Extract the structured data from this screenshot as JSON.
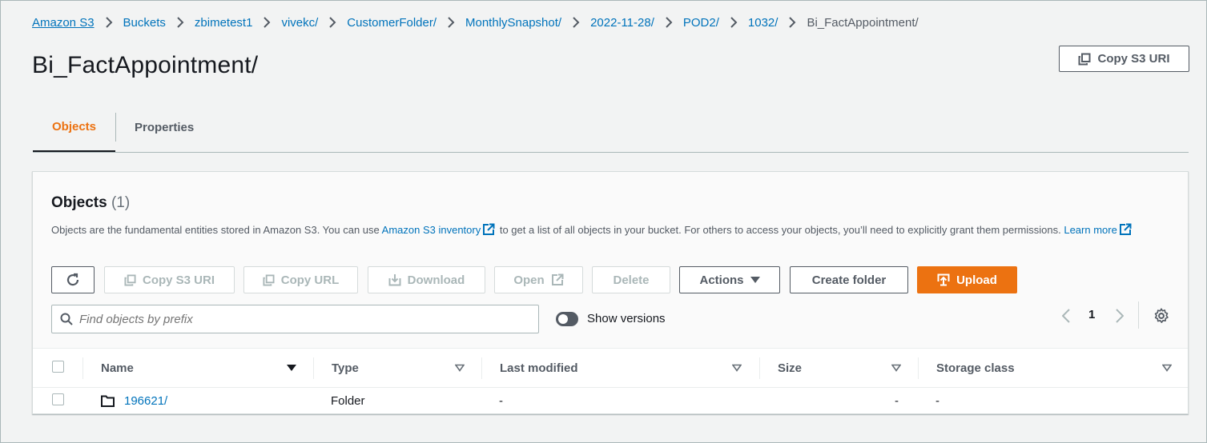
{
  "breadcrumb": [
    "Amazon S3",
    "Buckets",
    "zbimetest1",
    "vivekc/",
    "CustomerFolder/",
    "MonthlySnapshot/",
    "2022-11-28/",
    "POD2/",
    "1032/",
    "Bi_FactAppointment/"
  ],
  "page": {
    "title": "Bi_FactAppointment/",
    "copy_s3_uri_label": "Copy S3 URI"
  },
  "tabs": [
    {
      "label": "Objects",
      "active": true
    },
    {
      "label": "Properties",
      "active": false
    }
  ],
  "objects_panel": {
    "heading": "Objects",
    "count": "(1)",
    "description_before": "Objects are the fundamental entities stored in Amazon S3. You can use ",
    "inventory_link": "Amazon S3 inventory",
    "description_after": " to get a list of all objects in your bucket. For others to access your objects, you’ll need to explicitly grant them permissions. ",
    "learn_more_link": "Learn more"
  },
  "toolbar": {
    "refresh_icon": "refresh-icon",
    "copy_s3_uri": "Copy S3 URI",
    "copy_url": "Copy URL",
    "download": "Download",
    "open": "Open",
    "delete": "Delete",
    "actions": "Actions",
    "create_folder": "Create folder",
    "upload": "Upload"
  },
  "search": {
    "placeholder": "Find objects by prefix",
    "value": ""
  },
  "show_versions": {
    "label": "Show versions",
    "enabled": false
  },
  "pagination": {
    "current_page": "1"
  },
  "table": {
    "columns": [
      "Name",
      "Type",
      "Last modified",
      "Size",
      "Storage class"
    ],
    "rows": [
      {
        "name": "196621/",
        "type": "Folder",
        "last_modified": "-",
        "size": "-",
        "storage_class": "-"
      }
    ]
  },
  "colors": {
    "accent": "#ec7211",
    "link": "#0073bb",
    "text": "#16191f",
    "muted": "#545b64"
  }
}
